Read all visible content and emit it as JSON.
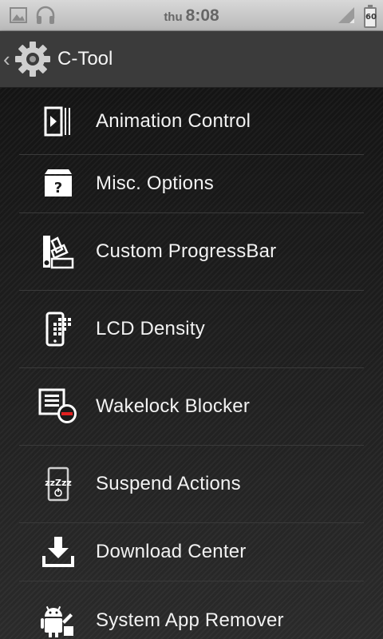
{
  "status_bar": {
    "day": "thu",
    "time": "8:08",
    "battery": "60",
    "icons": [
      "picture-icon",
      "headphones-icon",
      "signal-icon",
      "battery-icon"
    ]
  },
  "action_bar": {
    "title": "C-Tool",
    "icon": "gear-icon"
  },
  "menu": {
    "items": [
      {
        "label": "Animation Control",
        "icon": "animation-icon"
      },
      {
        "label": "Misc. Options",
        "icon": "misc-box-icon"
      },
      {
        "label": "Custom ProgressBar",
        "icon": "color-palette-icon"
      },
      {
        "label": "LCD Density",
        "icon": "lcd-density-icon"
      },
      {
        "label": "Wakelock Blocker",
        "icon": "wakelock-icon"
      },
      {
        "label": "Suspend Actions",
        "icon": "suspend-icon"
      },
      {
        "label": "Download Center",
        "icon": "download-icon"
      },
      {
        "label": "System App Remover",
        "icon": "android-remover-icon"
      }
    ]
  },
  "colors": {
    "status_bar": "#c8c8c8",
    "action_bar": "#3b3b3b",
    "background": "#141414",
    "text": "#f2f2f2"
  }
}
